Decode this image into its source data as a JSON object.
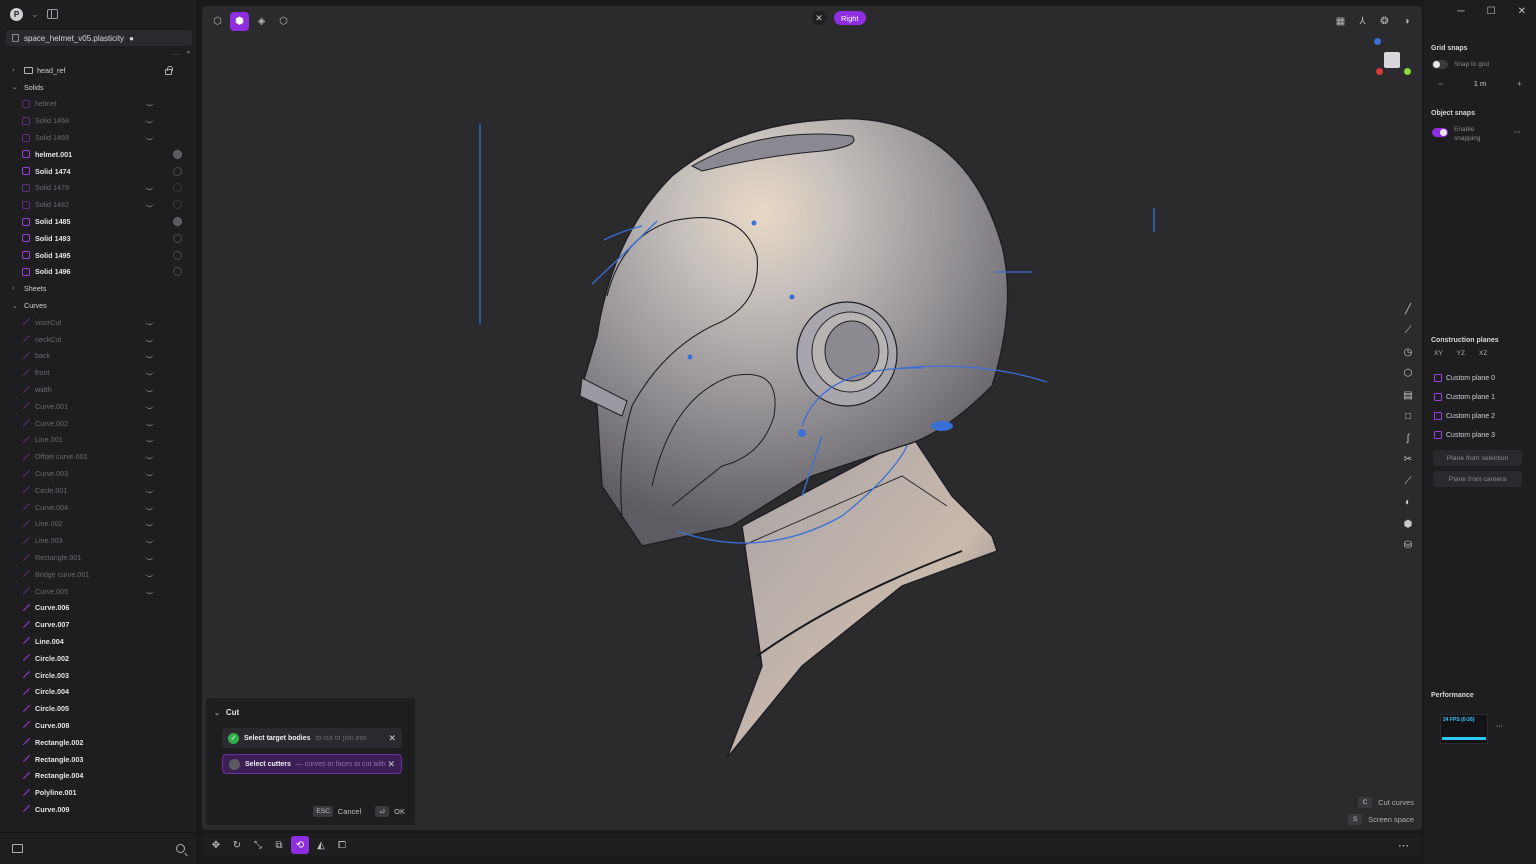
{
  "file": {
    "name": "space_helmet_v05.plasticity",
    "modified_marker": "●"
  },
  "app": {
    "logo_letter": "P"
  },
  "outliner": {
    "groups": [
      {
        "label": "head_ref",
        "expanded": false
      },
      {
        "label": "Solids",
        "expanded": true
      },
      {
        "label": "Sheets",
        "expanded": false
      },
      {
        "label": "Curves",
        "expanded": true
      }
    ],
    "solids": [
      {
        "label": "helmet",
        "hidden": true
      },
      {
        "label": "Solid 1468",
        "hidden": true
      },
      {
        "label": "Solid 1469",
        "hidden": true
      },
      {
        "label": "helmet.001",
        "hidden": false,
        "marker": "filled"
      },
      {
        "label": "Solid 1474",
        "hidden": false,
        "marker": "empty"
      },
      {
        "label": "Solid 1479",
        "hidden": true,
        "marker": "faint"
      },
      {
        "label": "Solid 1482",
        "hidden": true,
        "marker": "faint"
      },
      {
        "label": "Solid 1485",
        "hidden": false,
        "marker": "filled"
      },
      {
        "label": "Solid 1493",
        "hidden": false,
        "marker": "empty"
      },
      {
        "label": "Solid 1495",
        "hidden": false,
        "marker": "empty"
      },
      {
        "label": "Solid 1496",
        "hidden": false,
        "marker": "empty"
      }
    ],
    "curves": [
      {
        "label": "visorCut",
        "hidden": true
      },
      {
        "label": "neckCut",
        "hidden": true
      },
      {
        "label": "back",
        "hidden": true
      },
      {
        "label": "front",
        "hidden": true
      },
      {
        "label": "width",
        "hidden": true
      },
      {
        "label": "Curve.001",
        "hidden": true
      },
      {
        "label": "Curve.002",
        "hidden": true
      },
      {
        "label": "Line.001",
        "hidden": true
      },
      {
        "label": "Offset curve.001",
        "hidden": true
      },
      {
        "label": "Curve.003",
        "hidden": true
      },
      {
        "label": "Circle.001",
        "hidden": true
      },
      {
        "label": "Curve.004",
        "hidden": true
      },
      {
        "label": "Line.002",
        "hidden": true
      },
      {
        "label": "Line.003",
        "hidden": true
      },
      {
        "label": "Rectangle.001",
        "hidden": true
      },
      {
        "label": "Bridge curve.001",
        "hidden": true
      },
      {
        "label": "Curve.005",
        "hidden": true
      },
      {
        "label": "Curve.006",
        "hidden": false
      },
      {
        "label": "Curve.007",
        "hidden": false
      },
      {
        "label": "Line.004",
        "hidden": false
      },
      {
        "label": "Circle.002",
        "hidden": false
      },
      {
        "label": "Circle.003",
        "hidden": false
      },
      {
        "label": "Circle.004",
        "hidden": false
      },
      {
        "label": "Circle.005",
        "hidden": false
      },
      {
        "label": "Curve.008",
        "hidden": false
      },
      {
        "label": "Rectangle.002",
        "hidden": false
      },
      {
        "label": "Rectangle.003",
        "hidden": false
      },
      {
        "label": "Rectangle.004",
        "hidden": false
      },
      {
        "label": "Polyline.001",
        "hidden": false
      },
      {
        "label": "Curve.009",
        "hidden": false
      }
    ]
  },
  "viewport": {
    "view_label": "Right"
  },
  "cut_dialog": {
    "title": "Cut",
    "step1": {
      "label": "Select target bodies",
      "hint": "to cut or join into",
      "done": true
    },
    "step2": {
      "label": "Select cutters",
      "hint": "— curves or faces to cut with",
      "done": false
    },
    "cancel_key": "ESC",
    "cancel_label": "Cancel",
    "ok_key": "⏎",
    "ok_label": "OK"
  },
  "hints": [
    {
      "key": "C",
      "label": "Cut curves"
    },
    {
      "key": "S",
      "label": "Screen space"
    }
  ],
  "right_panel": {
    "grid_snaps_title": "Grid snaps",
    "snap_to_grid_label": "Snap to grid",
    "snap_to_grid_on": false,
    "grid_size": "1 m",
    "object_snaps_title": "Object snaps",
    "enable_snapping_label_1": "Enable",
    "enable_snapping_label_2": "snapping",
    "enable_snapping_on": true,
    "construction_planes_title": "Construction planes",
    "std_planes": [
      "XY",
      "YZ",
      "XZ"
    ],
    "custom_planes": [
      "Custom plane 0",
      "Custom plane 1",
      "Custom plane 2",
      "Custom plane 3"
    ],
    "plane_from_selection": "Plane from selection",
    "plane_from_camera": "Plane from camera",
    "performance_title": "Performance",
    "fps_text": "24 FPS (0-26)"
  },
  "colors": {
    "accent": "#8f2ee0",
    "curve_blue": "#3a6fd8",
    "success": "#2fb04a"
  }
}
